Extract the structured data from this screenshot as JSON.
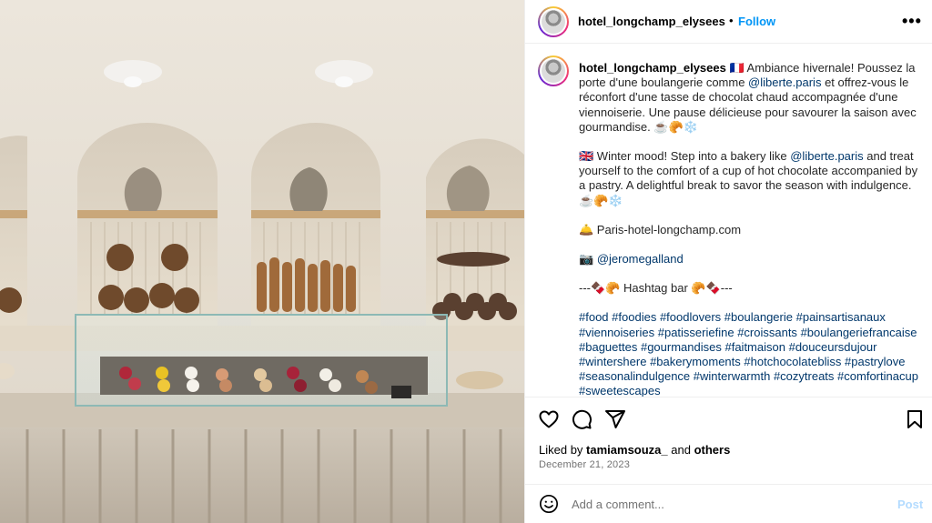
{
  "post": {
    "username": "hotel_longchamp_elysees",
    "separator": "•",
    "follow_label": "Follow",
    "more_label": "•••"
  },
  "caption": {
    "username": "hotel_longchamp_elysees",
    "line1": "🇫🇷 Ambiance hivernale! Poussez la porte d'une boulangerie comme ",
    "mention1": "@liberte.paris",
    "line1b": " et offrez-vous le réconfort d'une tasse de chocolat chaud accompagnée d'une viennoiserie. Une pause délicieuse pour savourer la saison avec gourmandise. ☕🥐❄️",
    "line2": "🇬🇧 Winter mood! Step into a bakery like ",
    "mention2": "@liberte.paris",
    "line2b": " and treat yourself to the comfort of a cup of hot chocolate accompanied by a pastry. A delightful break to savor the season with indulgence. ☕🥐❄️",
    "website": "🛎️ Paris-hotel-longchamp.com",
    "camera": "📷 ",
    "photographer": "@jeromegalland",
    "hashtag_bar": "---🍫🥐 Hashtag bar 🥐🍫---",
    "hashtags": [
      "#food",
      "#foodies",
      "#foodlovers",
      "#boulangerie",
      "#painsartisanaux",
      "#viennoiseries",
      "#patisseriefine",
      "#croissants",
      "#boulangeriefrancaise",
      "#baguettes",
      "#gourmandises",
      "#faitmaison",
      "#douceursdujour",
      "#wintershere",
      "#bakerymoments",
      "#hotchocolatebliss",
      "#pastrylove",
      "#seasonalindulgence",
      "#winterwarmth",
      "#cozytreats",
      "#comfortinacup",
      "#sweetescapes"
    ]
  },
  "engagement": {
    "liked_by_prefix": "Liked by ",
    "liked_by_user": "tamiamsouza_",
    "liked_by_mid": " and ",
    "liked_by_others": "others",
    "date": "December 21, 2023"
  },
  "comment": {
    "placeholder": "Add a comment...",
    "post_label": "Post"
  },
  "icons": {
    "like": "heart-icon",
    "comment": "comment-icon",
    "share": "paper-plane-icon",
    "save": "bookmark-icon",
    "emoji": "smiley-icon"
  },
  "colors": {
    "follow": "#0095f6",
    "link": "#00376b",
    "post_disabled": "#b3dbff",
    "muted": "#737373"
  }
}
